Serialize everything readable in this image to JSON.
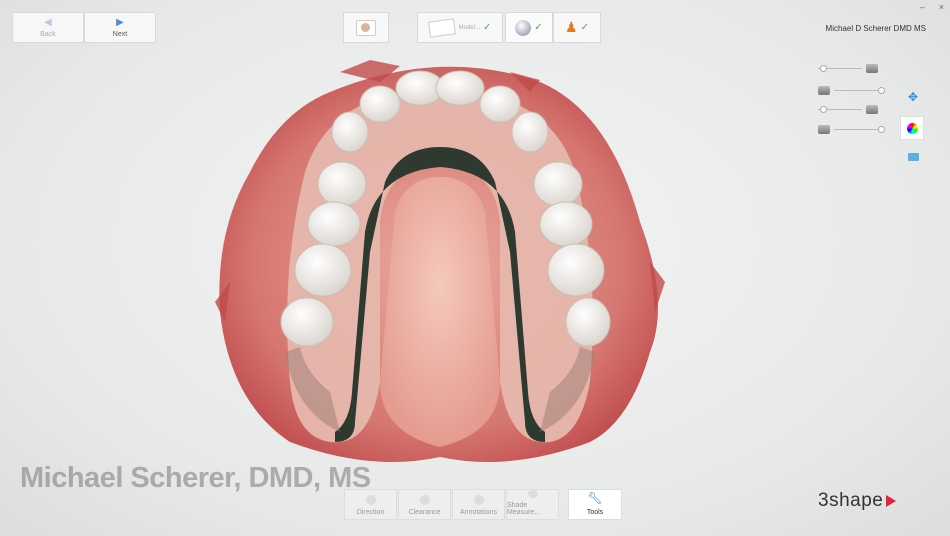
{
  "window": {
    "minimize": "–",
    "close": "×"
  },
  "nav": {
    "back_label": "Back",
    "next_label": "Next"
  },
  "workflow": {
    "order_sub": "Model...",
    "check": "✓"
  },
  "user": {
    "name": "Michael D Scherer DMD MS"
  },
  "watermark": "Michael Scherer, DMD, MS",
  "toolbar": {
    "items": [
      "Direction",
      "Clearance",
      "Annotations",
      "Shade Measure...",
      "Tools"
    ]
  },
  "logo": {
    "text": "3shape"
  },
  "colors": {
    "accent": "#2a8ad8",
    "check": "#4caf50",
    "brand": "#e2233a"
  }
}
